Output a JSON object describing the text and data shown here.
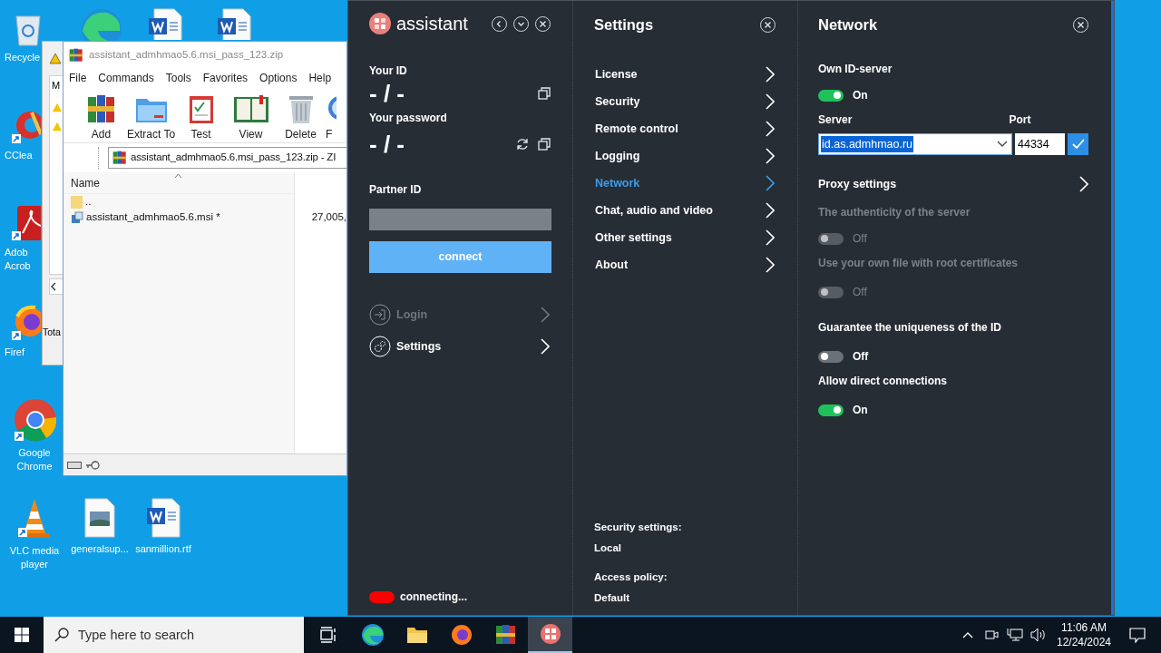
{
  "desktop_icons": [
    {
      "kind": "recycle-bin",
      "lines": [
        "Recycle"
      ]
    },
    {
      "kind": "cleaner",
      "lines": [
        "CClea"
      ]
    },
    {
      "kind": "pdf",
      "lines": [
        "Adob",
        "Acrob"
      ]
    },
    {
      "kind": "fox-browser",
      "lines": [
        "Firef"
      ]
    },
    {
      "kind": "chrome",
      "lines": [
        "Google",
        "Chrome"
      ]
    },
    {
      "kind": "cone",
      "lines": [
        "VLC media",
        "player"
      ]
    },
    {
      "kind": "image-file",
      "lines": [
        "generalsup..."
      ]
    },
    {
      "kind": "word-file",
      "lines": [
        "sanmillion.rtf"
      ]
    }
  ],
  "background_window": {
    "header_letter": "M",
    "footer_text": "Tota"
  },
  "archiver": {
    "title": "assistant_admhmao5.6.msi_pass_123.zip",
    "menu": [
      "File",
      "Commands",
      "Tools",
      "Favorites",
      "Options",
      "Help"
    ],
    "toolbar": [
      {
        "kind": "add",
        "label": "Add"
      },
      {
        "kind": "extract",
        "label": "Extract To"
      },
      {
        "kind": "test",
        "label": "Test"
      },
      {
        "kind": "view",
        "label": "View"
      },
      {
        "kind": "delete",
        "label": "Delete"
      },
      {
        "kind": "find",
        "label": "F"
      }
    ],
    "path": "assistant_admhmao5.6.msi_pass_123.zip - ZI",
    "columns": [
      "Name"
    ],
    "rows": [
      {
        "kind": "folder",
        "name": ".."
      },
      {
        "kind": "installer",
        "name": "assistant_admhmao5.6.msi *",
        "size": "27,005,"
      }
    ]
  },
  "assistant": {
    "brand": "assistant",
    "your_id_label": "Your ID",
    "your_id": "- / -",
    "password_label": "Your password",
    "password": "- / -",
    "partner_label": "Partner ID",
    "connect": "connect",
    "nav": [
      {
        "kind": "login",
        "label": "Login",
        "disabled": true
      },
      {
        "kind": "settings",
        "label": "Settings",
        "disabled": false
      }
    ],
    "status": {
      "text": "connecting...",
      "color": "#ff0000"
    }
  },
  "settings": {
    "title": "Settings",
    "items": [
      {
        "label": "License",
        "selected": false
      },
      {
        "label": "Security",
        "selected": false
      },
      {
        "label": "Remote control",
        "selected": false
      },
      {
        "label": "Logging",
        "selected": false
      },
      {
        "label": "Network",
        "selected": true
      },
      {
        "label": "Chat, audio and video",
        "selected": false
      },
      {
        "label": "Other settings",
        "selected": false
      },
      {
        "label": "About",
        "selected": false
      }
    ],
    "footer": [
      {
        "label": "Security settings:",
        "value": "Local"
      },
      {
        "label": "Access policy:",
        "value": "Default"
      }
    ]
  },
  "network": {
    "title": "Network",
    "own_id_server": {
      "label": "Own ID-server",
      "on": true,
      "state_text": "On",
      "disabled": false
    },
    "server": {
      "label": "Server",
      "value": "id.as.admhmao.ru",
      "text_selected": true
    },
    "port": {
      "label": "Port",
      "value": "44334"
    },
    "proxy": "Proxy settings",
    "toggles": [
      {
        "label": "The authenticity of the server",
        "on": false,
        "state_text": "Off",
        "disabled": true
      },
      {
        "label": "Use your own file with root certificates",
        "on": false,
        "state_text": "Off",
        "disabled": true
      },
      {
        "label": "Guarantee the uniqueness of the ID",
        "on": false,
        "state_text": "Off",
        "disabled": false
      },
      {
        "label": "Allow direct connections",
        "on": true,
        "state_text": "On",
        "disabled": false
      }
    ]
  },
  "taskbar": {
    "search_placeholder": "Type here to search",
    "apps": [
      {
        "kind": "task-view",
        "selected": false
      },
      {
        "kind": "edge",
        "selected": false
      },
      {
        "kind": "folder",
        "selected": false
      },
      {
        "kind": "firefox",
        "selected": false
      },
      {
        "kind": "archiver",
        "selected": false
      },
      {
        "kind": "assistant",
        "selected": true
      }
    ],
    "time": "11:06 AM",
    "date": "12/24/2024"
  }
}
